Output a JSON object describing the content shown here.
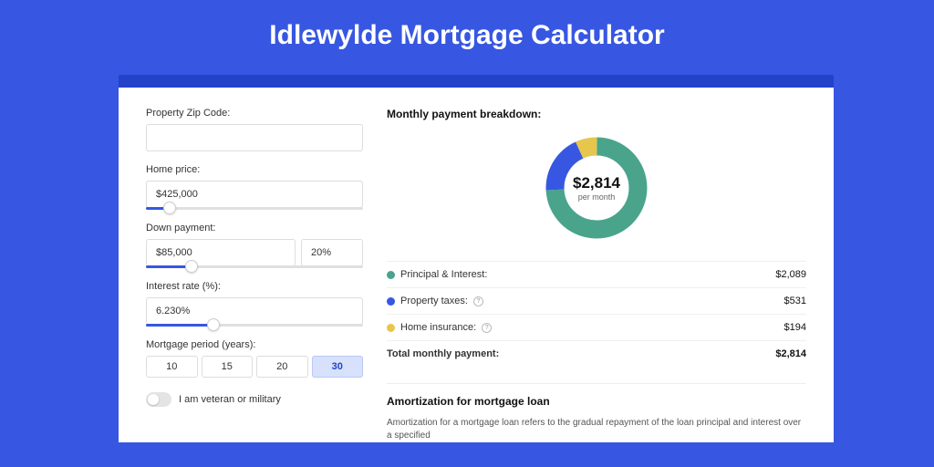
{
  "hero": {
    "title": "Idlewylde Mortgage Calculator"
  },
  "form": {
    "zip_label": "Property Zip Code:",
    "zip_value": "",
    "home_price_label": "Home price:",
    "home_price_value": "$425,000",
    "down_payment_label": "Down payment:",
    "down_payment_value": "$85,000",
    "down_payment_pct": "20%",
    "interest_label": "Interest rate (%):",
    "interest_value": "6.230%",
    "period_label": "Mortgage period (years):",
    "periods": [
      "10",
      "15",
      "20",
      "30"
    ],
    "period_active": "30",
    "veteran_label": "I am veteran or military"
  },
  "breakdown": {
    "title": "Monthly payment breakdown:",
    "donut_amount": "$2,814",
    "donut_sub": "per month",
    "rows": [
      {
        "color": "green",
        "label": "Principal & Interest:",
        "value": "$2,089",
        "info": false
      },
      {
        "color": "blue",
        "label": "Property taxes:",
        "value": "$531",
        "info": true
      },
      {
        "color": "yellow",
        "label": "Home insurance:",
        "value": "$194",
        "info": true
      }
    ],
    "total_label": "Total monthly payment:",
    "total_value": "$2,814"
  },
  "amort": {
    "title": "Amortization for mortgage loan",
    "text": "Amortization for a mortgage loan refers to the gradual repayment of the loan principal and interest over a specified"
  },
  "chart_data": {
    "type": "pie",
    "title": "Monthly payment breakdown",
    "series": [
      {
        "name": "Principal & Interest",
        "value": 2089,
        "color": "#49A48B"
      },
      {
        "name": "Property taxes",
        "value": 531,
        "color": "#3757E2"
      },
      {
        "name": "Home insurance",
        "value": 194,
        "color": "#E6C64C"
      }
    ],
    "total": 2814,
    "center_label": "$2,814 per month"
  }
}
